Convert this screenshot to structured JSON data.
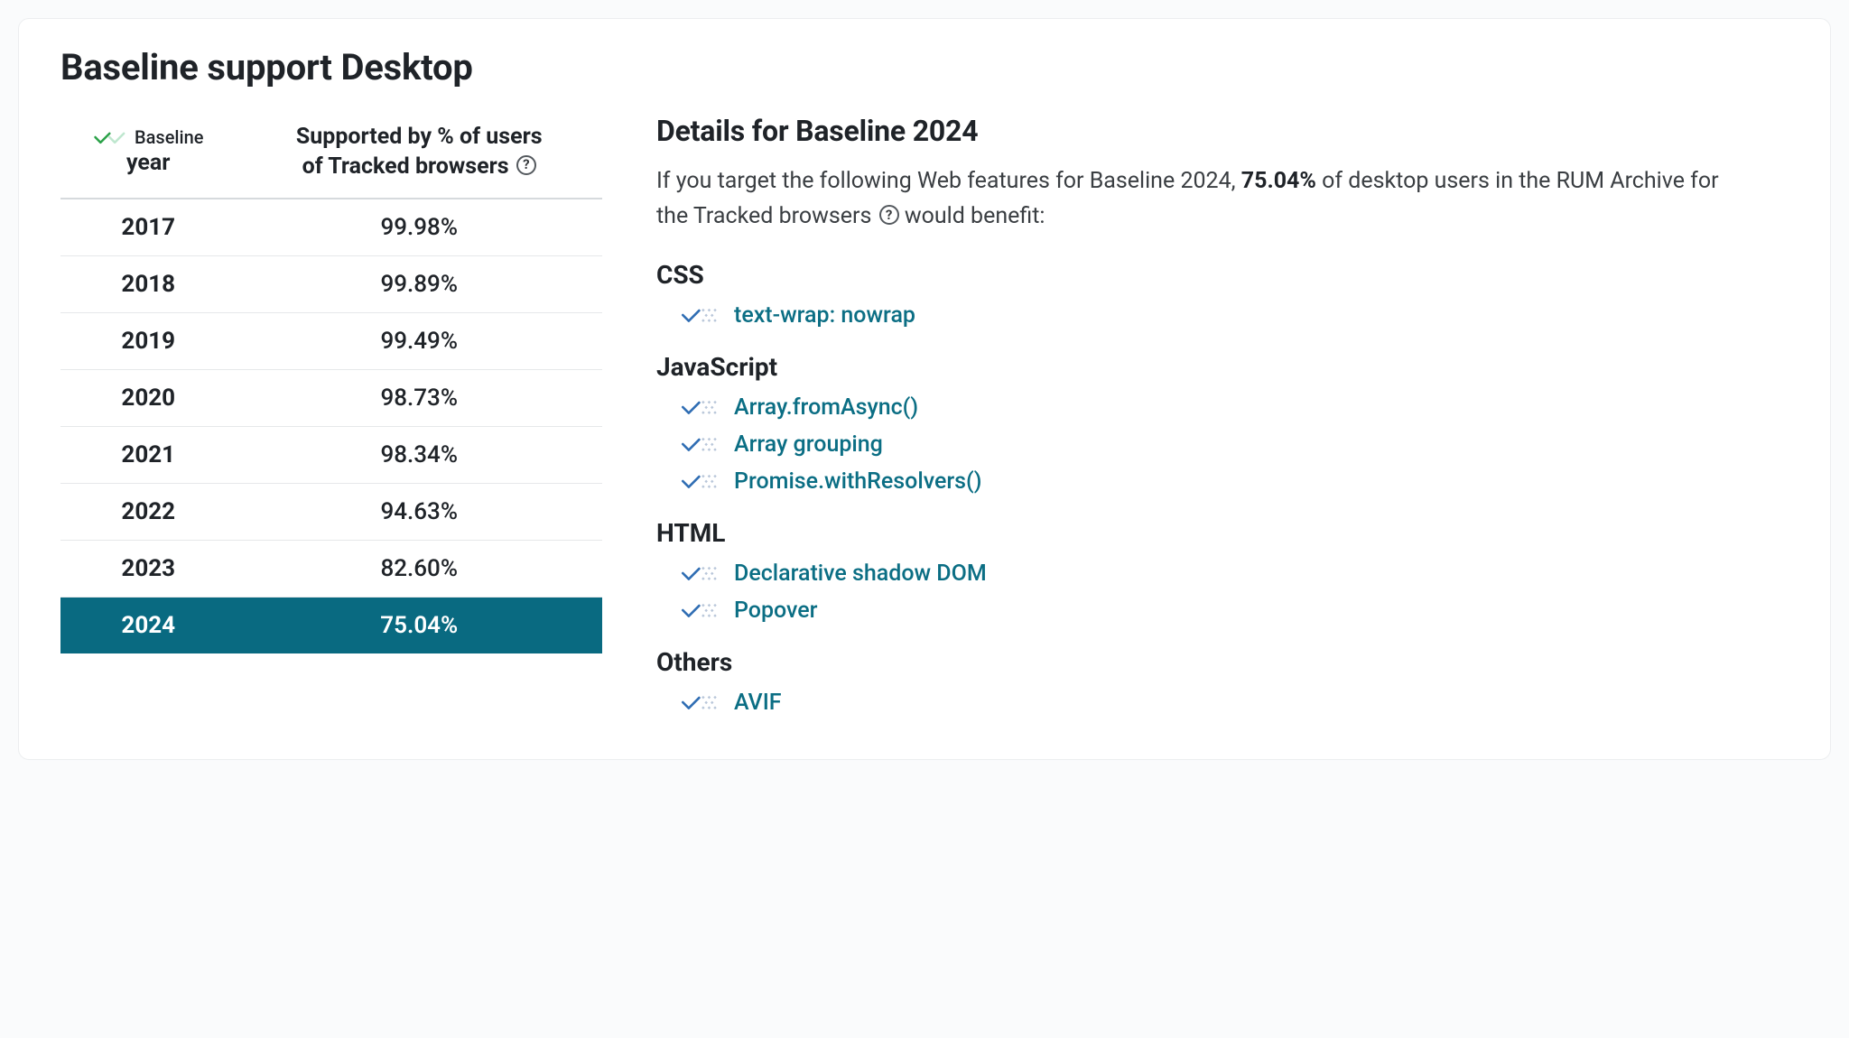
{
  "title": "Baseline support Desktop",
  "table": {
    "header_logo_text": "Baseline",
    "col1_line1": "",
    "col1_line2": "year",
    "col2_line1": "Supported by % of users",
    "col2_line2": "of Tracked browsers",
    "rows": [
      {
        "year": "2017",
        "pct": "99.98%",
        "selected": false
      },
      {
        "year": "2018",
        "pct": "99.89%",
        "selected": false
      },
      {
        "year": "2019",
        "pct": "99.49%",
        "selected": false
      },
      {
        "year": "2020",
        "pct": "98.73%",
        "selected": false
      },
      {
        "year": "2021",
        "pct": "98.34%",
        "selected": false
      },
      {
        "year": "2022",
        "pct": "94.63%",
        "selected": false
      },
      {
        "year": "2023",
        "pct": "82.60%",
        "selected": false
      },
      {
        "year": "2024",
        "pct": "75.04%",
        "selected": true
      }
    ]
  },
  "details": {
    "heading": "Details for Baseline 2024",
    "intro_prefix": "If you target the following Web features for Baseline 2024, ",
    "intro_pct": "75.04%",
    "intro_mid": " of desktop users in the RUM Archive for the Tracked browsers ",
    "intro_suffix": " would benefit:",
    "groups": [
      {
        "title": "CSS",
        "items": [
          "text-wrap: nowrap"
        ]
      },
      {
        "title": "JavaScript",
        "items": [
          "Array.fromAsync()",
          "Array grouping",
          "Promise.withResolvers()"
        ]
      },
      {
        "title": "HTML",
        "items": [
          "Declarative shadow DOM",
          "Popover"
        ]
      },
      {
        "title": "Others",
        "items": [
          "AVIF"
        ]
      }
    ]
  },
  "chart_data": {
    "type": "table",
    "title": "Baseline support Desktop — Supported by % of users of Tracked browsers",
    "columns": [
      "Baseline year",
      "Supported by % of users of Tracked browsers"
    ],
    "categories": [
      "2017",
      "2018",
      "2019",
      "2020",
      "2021",
      "2022",
      "2023",
      "2024"
    ],
    "values": [
      99.98,
      99.89,
      99.49,
      98.73,
      98.34,
      94.63,
      82.6,
      75.04
    ],
    "selected_year": "2024",
    "unit": "%"
  }
}
